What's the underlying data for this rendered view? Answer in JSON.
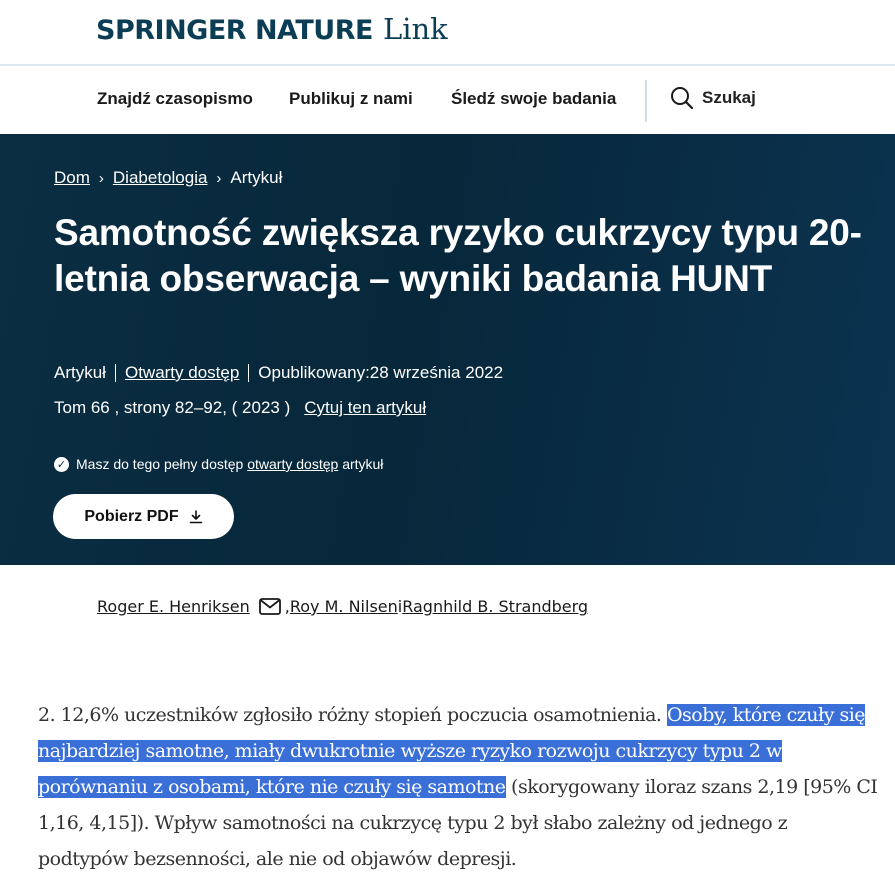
{
  "brand": {
    "name": "SPRINGER NATURE",
    "suffix": "Link"
  },
  "nav": {
    "items": [
      "Znajdź czasopismo",
      "Publikuj z nami",
      "Śledź swoje badania"
    ],
    "search_label": "Szukaj"
  },
  "breadcrumb": {
    "items": [
      "Dom",
      "Diabetologia",
      "Artykuł"
    ]
  },
  "article": {
    "title": "Samotność zwiększa ryzyko cukrzycy typu 20-letnia obserwacja – wyniki badania HUNT",
    "type": "Artykuł",
    "access": "Otwarty dostęp",
    "published": "Opublikowany:28 września 2022",
    "volume_pages": "Tom 66 , strony 82–92, ( 2023 )",
    "cite_label": "Cytuj ten artykuł",
    "access_note_prefix": "Masz do tego pełny dostęp",
    "access_note_link": "otwarty dostęp",
    "access_note_suffix": "artykuł",
    "pdf_button": "Pobierz PDF"
  },
  "authors": {
    "author1": "Roger E. Henriksen",
    "sep1": ",",
    "author2": "Roy M. Nilsen",
    "sep2": "i",
    "author3": "Ragnhild B. Strandberg"
  },
  "body": {
    "before": "2. 12,6% uczestników zgłosiło różny stopień poczucia osamotnienia. ",
    "highlighted": "Osoby, które czuły się najbardziej samotne, miały dwukrotnie wyższe ryzyko rozwoju cukrzycy typu 2 w porównaniu z osobami, które nie czuły się samotne",
    "after": " (skorygowany iloraz szans 2,19 [95% CI 1,16, 4,15]). Wpływ samotności na cukrzycę typu 2 był słabo zależny od jednego z podtypów bezsenności, ale nie od objawów depresji."
  },
  "colors": {
    "brand": "#0b3d54",
    "hero_bg": "#0b2e43",
    "highlight": "#3a6fd8"
  },
  "icons": [
    "search-icon",
    "chevron-right-icon",
    "check-circle-icon",
    "download-icon",
    "mail-icon"
  ]
}
